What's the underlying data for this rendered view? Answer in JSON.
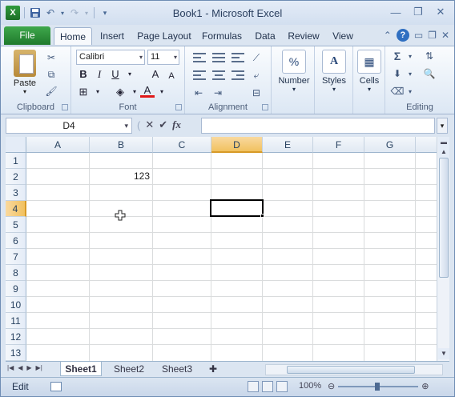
{
  "window": {
    "title": "Book1 - Microsoft Excel"
  },
  "qat": {
    "icons": [
      "excel-logo",
      "save-icon",
      "undo-icon",
      "redo-icon",
      "customize-icon"
    ]
  },
  "tabs": [
    {
      "label": "File"
    },
    {
      "label": "Home"
    },
    {
      "label": "Insert"
    },
    {
      "label": "Page Layout"
    },
    {
      "label": "Formulas"
    },
    {
      "label": "Data"
    },
    {
      "label": "Review"
    },
    {
      "label": "View"
    }
  ],
  "ribbon": {
    "clipboard": {
      "label": "Clipboard",
      "paste": "Paste"
    },
    "font": {
      "label": "Font",
      "name": "Calibri",
      "size": "11",
      "bold": "B",
      "italic": "I",
      "underline": "U",
      "grow": "A",
      "shrink": "A",
      "color": "A"
    },
    "alignment": {
      "label": "Alignment"
    },
    "number": {
      "label": "Number",
      "icon": "%"
    },
    "styles": {
      "label": "Styles"
    },
    "cells": {
      "label": "Cells"
    },
    "editing": {
      "label": "Editing",
      "sum": "Σ"
    }
  },
  "formula_bar": {
    "name_box": "D4",
    "fx": "fx",
    "formula": ""
  },
  "grid": {
    "columns": [
      "A",
      "B",
      "C",
      "D",
      "E",
      "F",
      "G"
    ],
    "rows": [
      "1",
      "2",
      "3",
      "4",
      "5",
      "6",
      "7",
      "8",
      "9",
      "10",
      "11",
      "12",
      "13"
    ],
    "selected_column": "D",
    "selected_row": "4",
    "cells": {
      "B2": "123"
    }
  },
  "sheets": [
    {
      "label": "Sheet1"
    },
    {
      "label": "Sheet2"
    },
    {
      "label": "Sheet3"
    }
  ],
  "status": {
    "mode": "Edit",
    "zoom": "100%"
  }
}
